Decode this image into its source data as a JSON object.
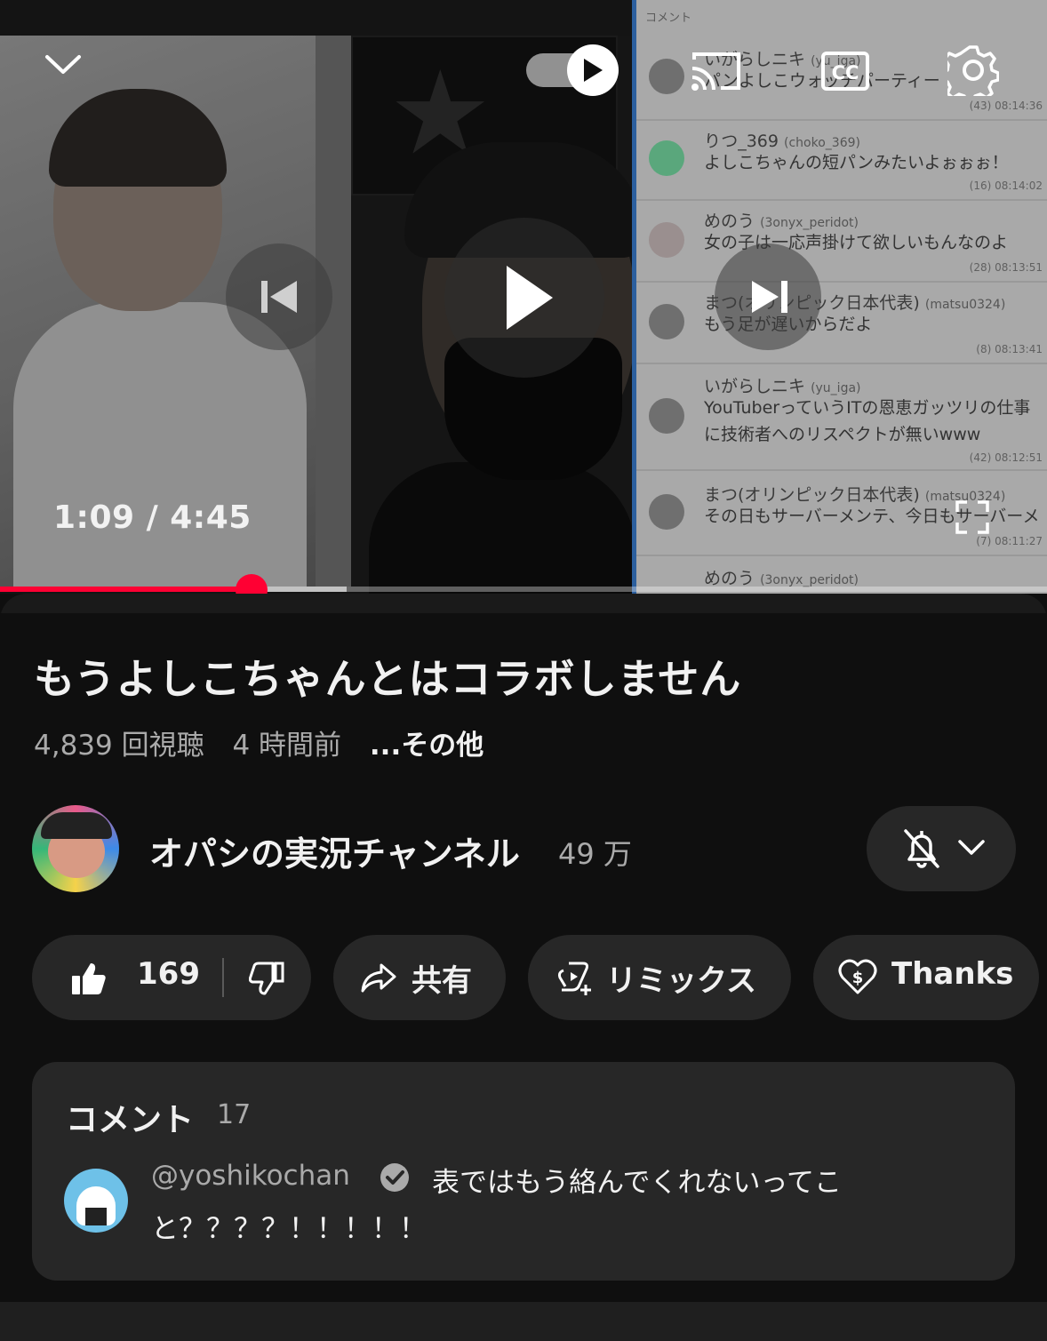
{
  "player": {
    "time_display": "1:09 / 4:45",
    "progress_fraction": 0.24,
    "accent_color": "#ff0033",
    "icons": [
      "chevron-down-icon",
      "autoplay-toggle-icon",
      "cast-icon",
      "cc-icon",
      "gear-icon",
      "previous-icon",
      "play-icon",
      "next-icon",
      "fullscreen-icon"
    ],
    "chat_overlay": {
      "header": "コメント",
      "rows": [
        {
          "name": "いがらしニキ",
          "handle": "(yu_iga)",
          "text": "パンよしこウォッチパーティー",
          "meta": "(43)  08:14:36"
        },
        {
          "name": "りつ_369",
          "handle": "(choko_369)",
          "text": "よしこちゃんの短パンみたいよぉぉぉ！",
          "meta": "(16)  08:14:02"
        },
        {
          "name": "めのう",
          "handle": "(3onyx_peridot)",
          "text": "女の子は一応声掛けて欲しいもんなのよ",
          "meta": "(28)  08:13:51"
        },
        {
          "name": "まつ(オリンピック日本代表)",
          "handle": "(matsu0324)",
          "text": "もう足が遅いからだよ",
          "meta": "(8)  08:13:41"
        },
        {
          "name": "いがらしニキ",
          "handle": "(yu_iga)",
          "text": "YouTuberっていうITの恩恵ガッツリの仕事",
          "text2": "に技術者へのリスペクトが無いwww",
          "meta": "(42)  08:12:51"
        },
        {
          "name": "まつ(オリンピック日本代表)",
          "handle": "(matsu0324)",
          "text": "その日もサーバーメンテ、今日もサーバーメ",
          "meta": "(7)  08:11:27"
        },
        {
          "name": "めのう",
          "handle": "(3onyx_peridot)",
          "text": "",
          "meta": ""
        }
      ]
    }
  },
  "video": {
    "title": "もうよしこちゃんとはコラボしません",
    "views": "4,839 回視聴",
    "age": "4 時間前",
    "more_label": "...その他"
  },
  "channel": {
    "name": "オパシの実況チャンネル",
    "subscribers": "49 万",
    "avatar_icon": "channel-avatar"
  },
  "actions": {
    "like_count": "169",
    "share_label": "共有",
    "remix_label": "リミックス",
    "thanks_label": "Thanks"
  },
  "comments": {
    "title": "コメント",
    "count": "17",
    "top_comment": {
      "handle": "@yoshikochan",
      "text_line1": "表ではもう絡んでくれないってこ",
      "text_line2": "と？？？？！！！！！"
    }
  }
}
